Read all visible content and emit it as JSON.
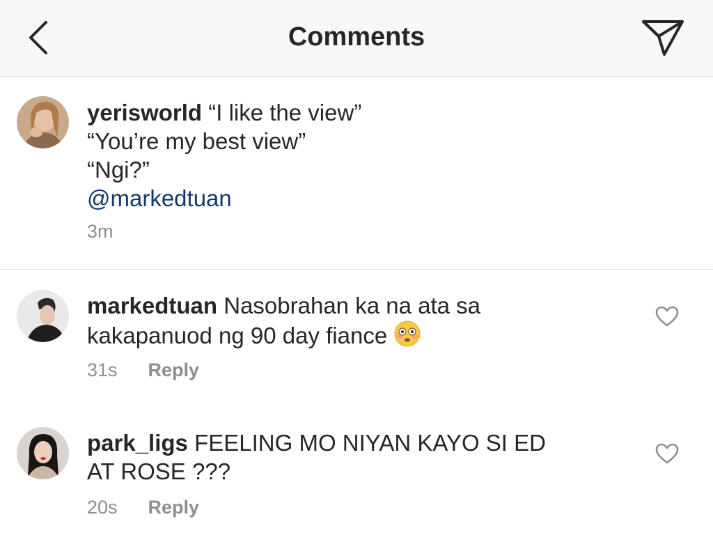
{
  "header": {
    "title": "Comments",
    "back_icon": "chevron-left-icon",
    "share_icon": "paper-plane-icon"
  },
  "caption": {
    "username": "yerisworld",
    "line1": "“I like the view”",
    "line2": "“You’re my best view”",
    "line3": "“Ngi?”",
    "mention": "@markedtuan",
    "time": "3m"
  },
  "comments": [
    {
      "username": "markedtuan",
      "text_line1": "Nasobrahan ka na ata sa",
      "text_line2": "kakapanuod ng 90 day fiance",
      "emoji": "flushed-face-emoji",
      "time": "31s",
      "reply": "Reply"
    },
    {
      "username": "park_ligs",
      "text_line1": "FEELING MO NIYAN KAYO SI ED",
      "text_line2": "AT ROSE ???",
      "time": "20s",
      "reply": "Reply"
    }
  ],
  "colors": {
    "text": "#262626",
    "muted": "#8e8e8e",
    "mention": "#143a6a",
    "header_bg": "#f8f8f8"
  }
}
